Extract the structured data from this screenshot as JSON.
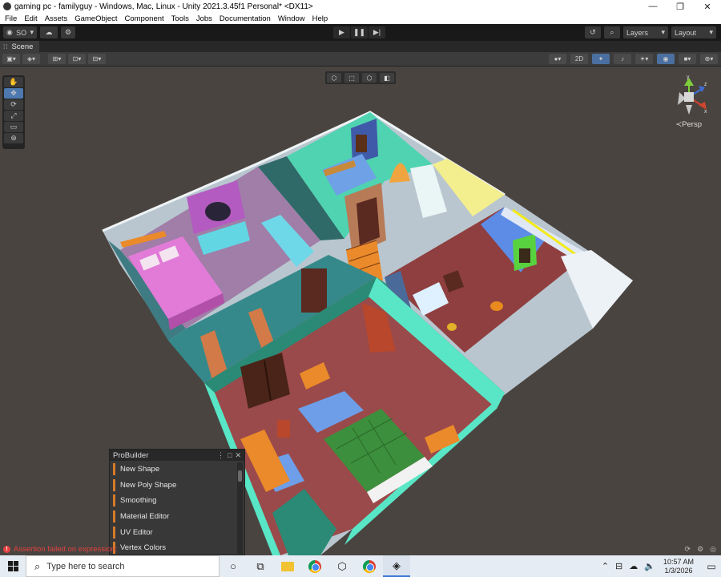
{
  "window": {
    "title": "gaming pc - familyguy - Windows, Mac, Linux - Unity 2021.3.45f1 Personal* <DX11>",
    "controls": [
      "—",
      "❐",
      "✕"
    ]
  },
  "menu": [
    "File",
    "Edit",
    "Assets",
    "GameObject",
    "Component",
    "Tools",
    "Jobs",
    "Documentation",
    "Window",
    "Help"
  ],
  "toolbar": {
    "account_label": "SO",
    "layers_label": "Layers",
    "layout_label": "Layout"
  },
  "scene_tab": {
    "label": "Scene"
  },
  "scene_view": {
    "persp_label": "≺Persp",
    "gizmo_axes": {
      "y": "y",
      "x": "x",
      "z": "z"
    },
    "mode_2d_label": "2D"
  },
  "probuilder": {
    "title": "ProBuilder",
    "items": [
      "New Shape",
      "New Poly Shape",
      "Smoothing",
      "Material Editor",
      "UV Editor",
      "Vertex Colors"
    ]
  },
  "status": {
    "error_text": "Assertion failed on expression:"
  },
  "taskbar": {
    "search_placeholder": "Type here to search",
    "time": "10:57 AM",
    "date": "1/3/2026"
  },
  "colors": {
    "scene_background": "#4a4440",
    "active_blue": "#4d79b0",
    "probuilder_accent": "#d97a2a",
    "error_red": "#e34242"
  }
}
